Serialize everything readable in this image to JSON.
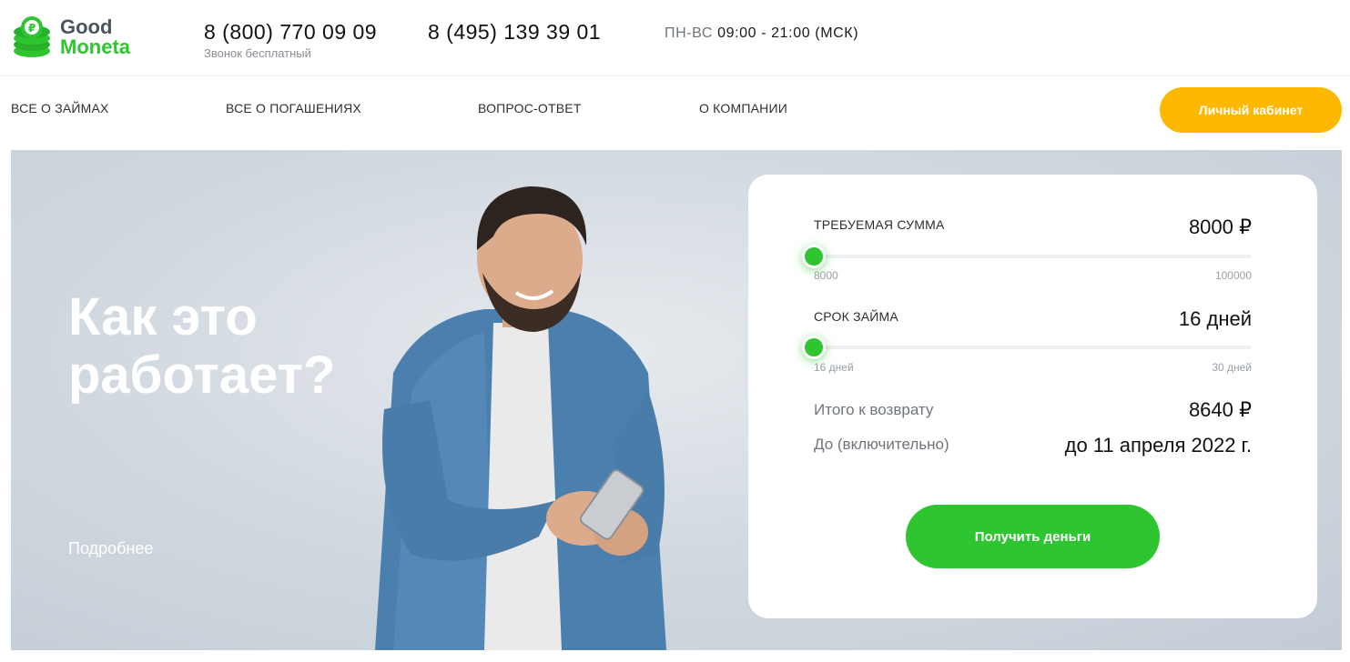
{
  "brand": {
    "line1": "Good",
    "line2": "Moneta",
    "accent": "#2fc531",
    "dark": "#4b5560"
  },
  "contacts": {
    "phone1": "8 (800) 770 09 09",
    "phone1_note": "Звонок бесплатный",
    "phone2": "8 (495) 139 39 01",
    "hours_days": "ПН-ВС",
    "hours_time": "09:00 - 21:00 (МСК)"
  },
  "nav": {
    "items": [
      {
        "label": "ВСЕ О ЗАЙМАХ"
      },
      {
        "label": "ВСЕ О ПОГАШЕНИЯХ"
      },
      {
        "label": "ВОПРОС-ОТВЕТ"
      },
      {
        "label": "О КОМПАНИИ"
      }
    ],
    "cabinet_label": "Личный кабинет",
    "cabinet_color": "#ffb800"
  },
  "hero": {
    "title_line1": "Как это",
    "title_line2": "работает?",
    "more_label": "Подробнее"
  },
  "calculator": {
    "amount": {
      "label": "ТРЕБУЕМАЯ СУММА",
      "value": "8000 ₽",
      "min": "8000",
      "max": "100000",
      "position": 0
    },
    "term": {
      "label": "СРОК ЗАЙМА",
      "value": "16 дней",
      "min": "16 дней",
      "max": "30 дней",
      "position": 0
    },
    "total_label": "Итого к возврату",
    "total_value": "8640 ₽",
    "until_label": "До (включительно)",
    "until_value": "до 11 апреля 2022 г.",
    "submit_label": "Получить деньги"
  }
}
